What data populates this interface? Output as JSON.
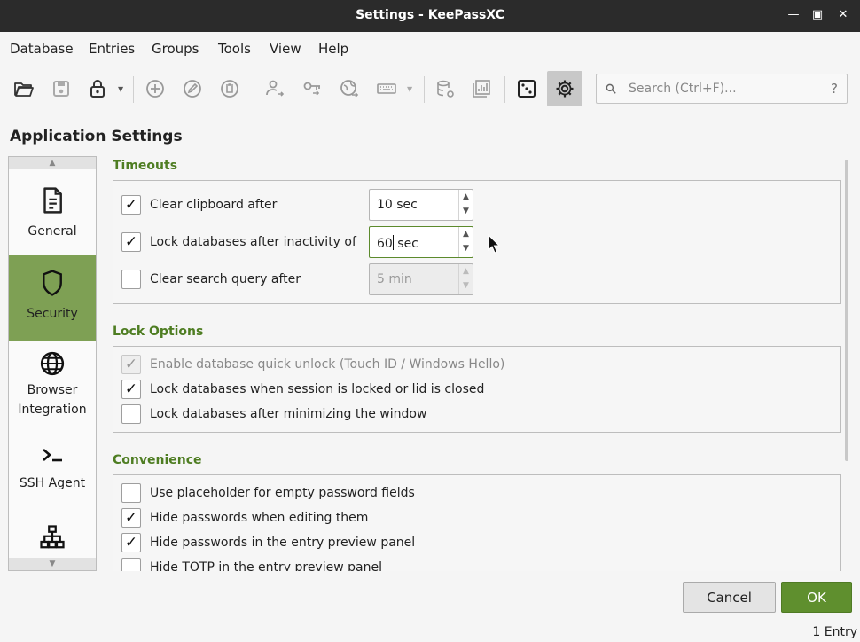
{
  "window": {
    "title": "Settings - KeePassXC"
  },
  "menu": [
    "Database",
    "Entries",
    "Groups",
    "Tools",
    "View",
    "Help"
  ],
  "search": {
    "placeholder": "Search (Ctrl+F)...",
    "help": "?"
  },
  "page_title": "Application Settings",
  "categories": [
    {
      "label": "General",
      "icon": "document-icon"
    },
    {
      "label": "Security",
      "icon": "shield-icon",
      "selected": true
    },
    {
      "label": "Browser Integration",
      "icon": "globe-icon"
    },
    {
      "label": "SSH Agent",
      "icon": "terminal-icon"
    },
    {
      "label": "",
      "icon": "network-icon"
    }
  ],
  "timeouts": {
    "title": "Timeouts",
    "clear_clipboard": {
      "label": "Clear clipboard after",
      "checked": true,
      "value": "10 sec"
    },
    "lock_inactivity": {
      "label": "Lock databases after inactivity of",
      "checked": true,
      "value_a": "60",
      "value_b": " sec"
    },
    "clear_search": {
      "label": "Clear search query after",
      "checked": false,
      "value": "5 min"
    }
  },
  "lock_options": {
    "title": "Lock Options",
    "items": [
      {
        "label": "Enable database quick unlock (Touch ID / Windows Hello)",
        "checked": true,
        "disabled": true
      },
      {
        "label": "Lock databases when session is locked or lid is closed",
        "checked": true
      },
      {
        "label": "Lock databases after minimizing the window",
        "checked": false
      }
    ]
  },
  "convenience": {
    "title": "Convenience",
    "items": [
      {
        "label": "Use placeholder for empty password fields",
        "checked": false
      },
      {
        "label": "Hide passwords when editing them",
        "checked": true
      },
      {
        "label": "Hide passwords in the entry preview panel",
        "checked": true
      },
      {
        "label": "Hide TOTP in the entry preview panel",
        "checked": false
      }
    ]
  },
  "buttons": {
    "cancel": "Cancel",
    "ok": "OK"
  },
  "status": "1 Entry",
  "colors": {
    "accent": "#5f8f2e",
    "section_title": "#4e7d22",
    "selected_category": "#7ea054"
  }
}
